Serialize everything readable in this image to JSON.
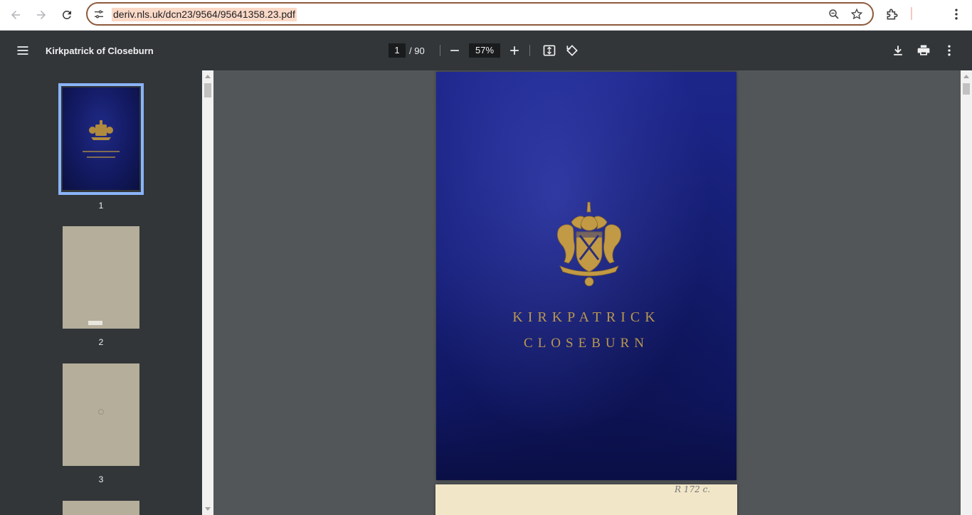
{
  "browser": {
    "url": "deriv.nls.uk/dcn23/9564/95641358.23.pdf"
  },
  "toolbar": {
    "title": "Kirkpatrick of Closeburn",
    "current_page": "1",
    "total_pages": "/ 90",
    "zoom": "57%"
  },
  "sidebar": {
    "thumbnails": [
      {
        "label": "1",
        "selected": true
      },
      {
        "label": "2",
        "selected": false
      },
      {
        "label": "3",
        "selected": false
      }
    ]
  },
  "cover": {
    "line1": "KIRKPATRICK",
    "line2": "CLOSEBURN"
  },
  "page2": {
    "handwritten_note": "R 172 c."
  },
  "colors": {
    "toolbar_bg": "#323639",
    "viewer_bg": "#525659",
    "selection": "#8ab4f8",
    "gold": "#b9984e",
    "cover_blue": "#17207a"
  },
  "icons": [
    "back-icon",
    "forward-icon",
    "reload-icon",
    "site-info-icon",
    "zoom-icon",
    "star-icon",
    "extensions-icon",
    "kebab-menu-icon",
    "hamburger-icon",
    "zoom-out-icon",
    "zoom-in-icon",
    "fit-page-icon",
    "rotate-icon",
    "download-icon",
    "print-icon",
    "more-icon"
  ]
}
